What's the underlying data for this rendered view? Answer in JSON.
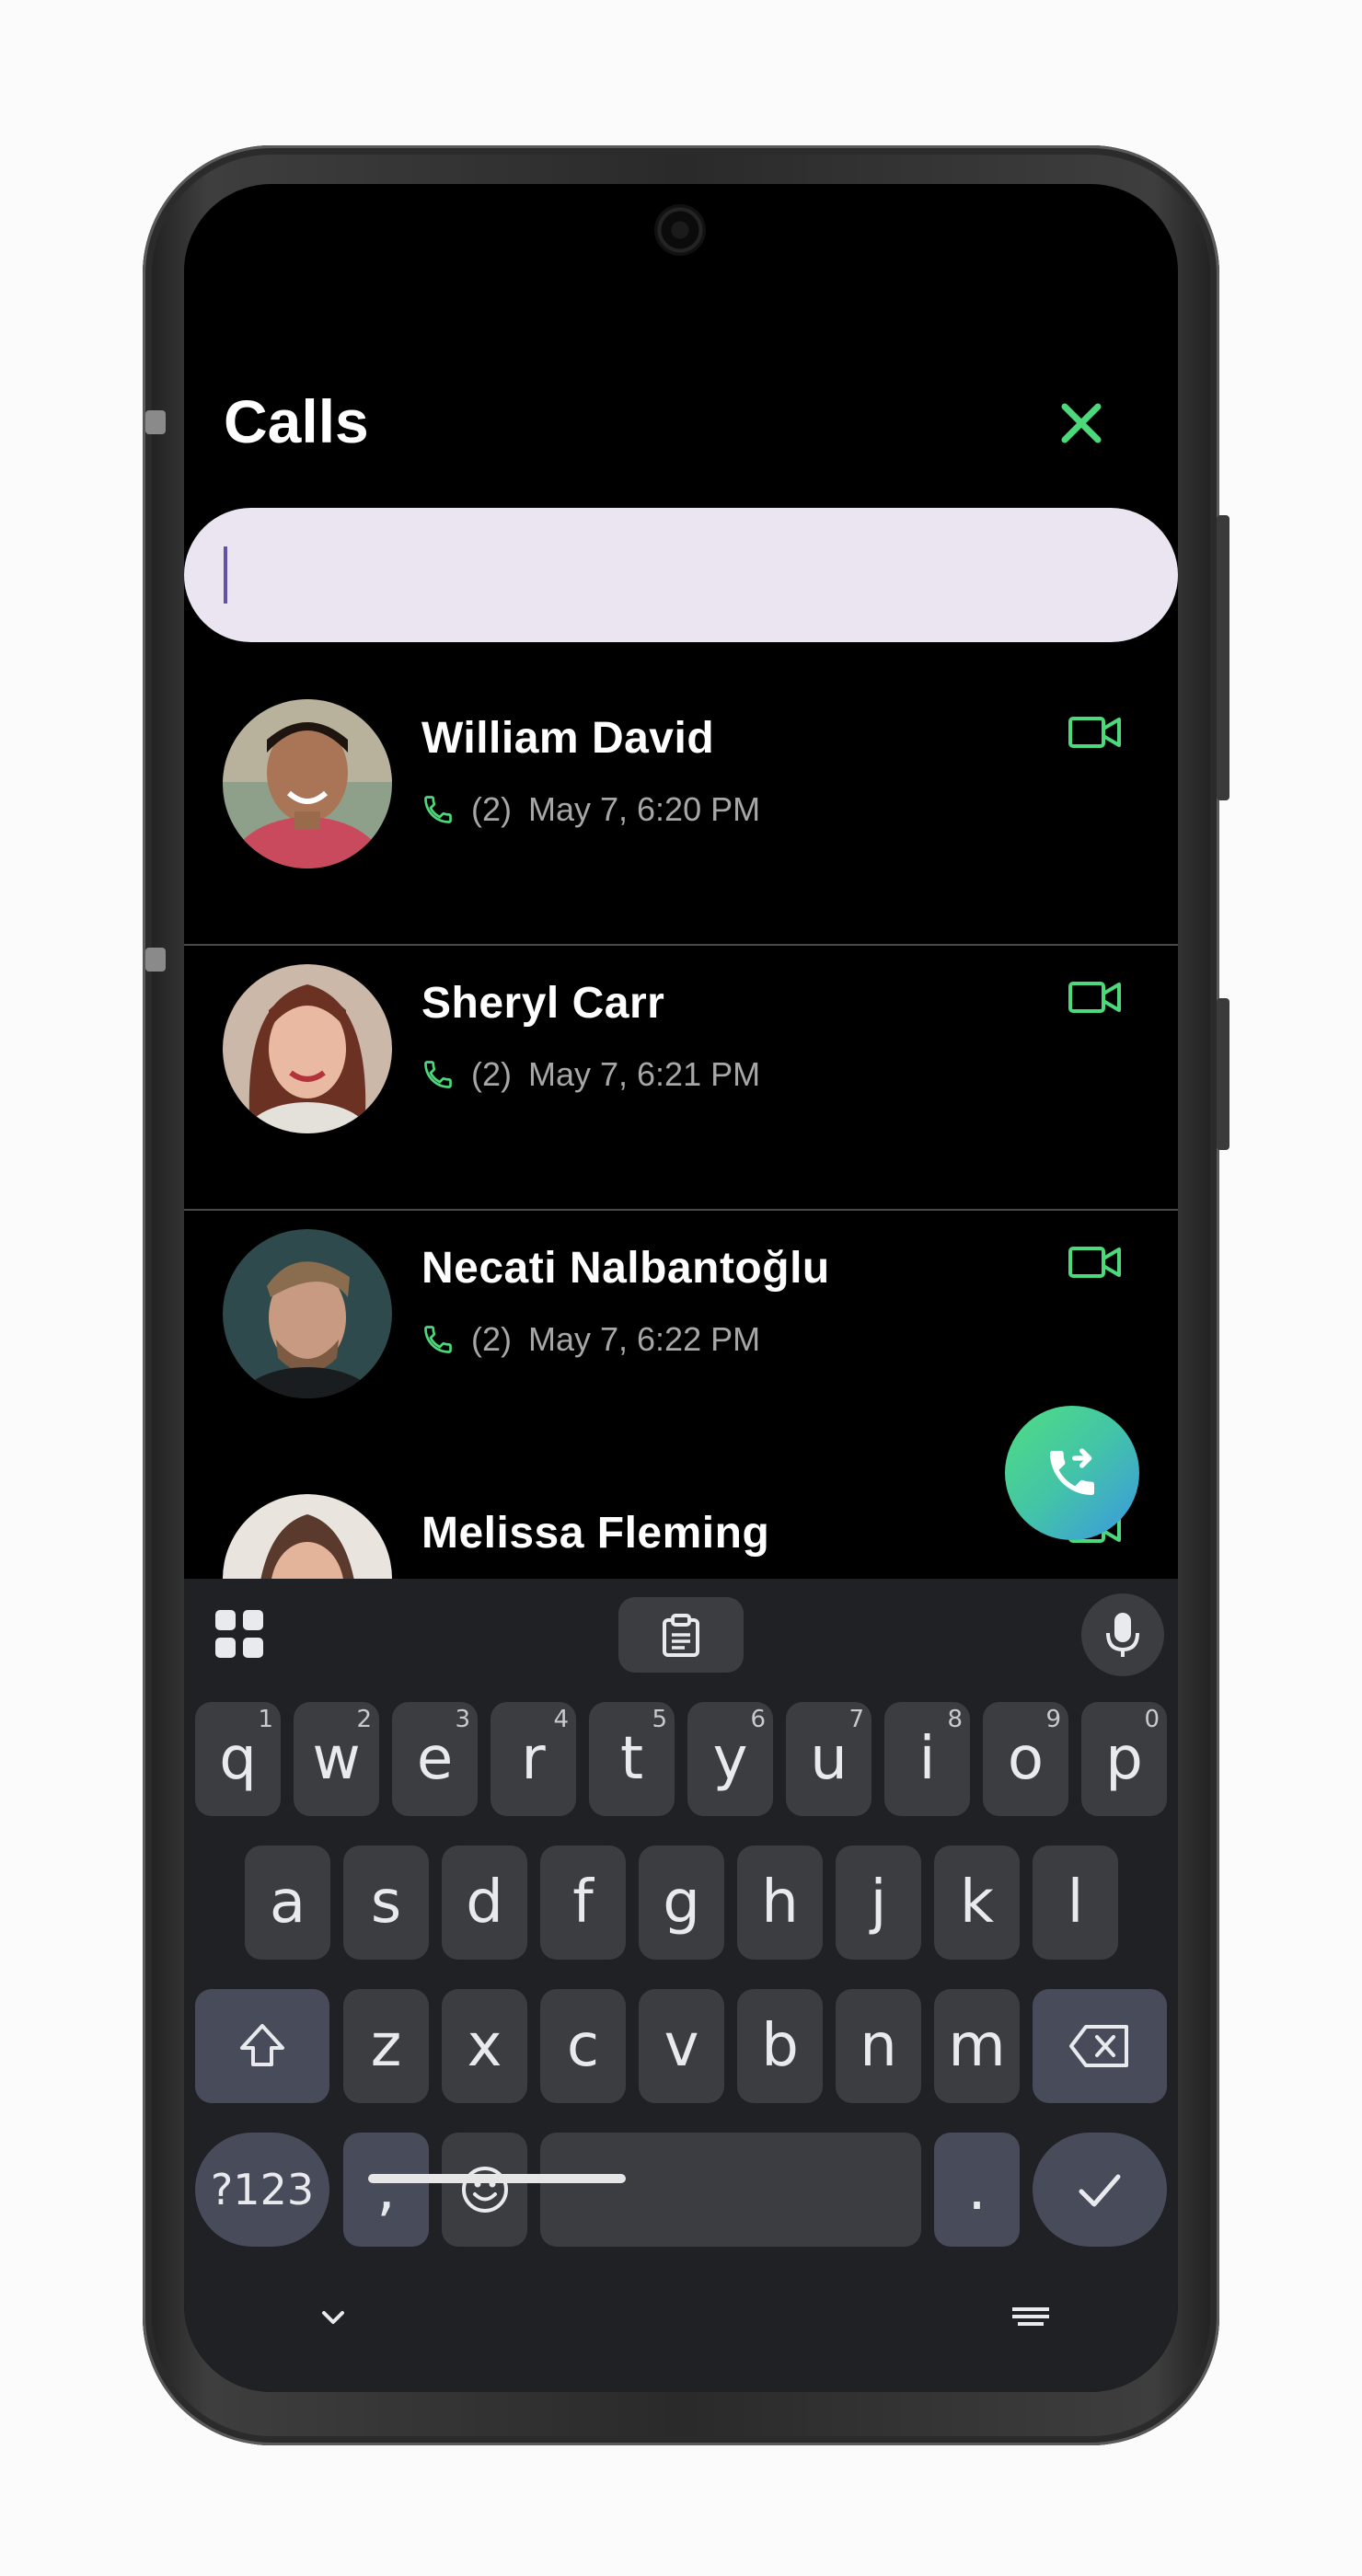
{
  "header": {
    "title": "Calls"
  },
  "search": {
    "value": "",
    "placeholder": ""
  },
  "calls": [
    {
      "name": "William David",
      "count": "(2)",
      "time": "May 7, 6:20 PM",
      "avatar_color": "#7a5a48"
    },
    {
      "name": "Sheryl Carr",
      "count": "(2)",
      "time": "May 7, 6:21 PM",
      "avatar_color": "#9a6a55"
    },
    {
      "name": "Necati Nalbantoğlu",
      "count": "(2)",
      "time": "May 7, 6:22 PM",
      "avatar_color": "#3c4a4d"
    },
    {
      "name": "Melissa Fleming",
      "count": "",
      "time": "",
      "avatar_color": "#8d6e63"
    }
  ],
  "keyboard": {
    "row1": [
      {
        "k": "q",
        "h": "1"
      },
      {
        "k": "w",
        "h": "2"
      },
      {
        "k": "e",
        "h": "3"
      },
      {
        "k": "r",
        "h": "4"
      },
      {
        "k": "t",
        "h": "5"
      },
      {
        "k": "y",
        "h": "6"
      },
      {
        "k": "u",
        "h": "7"
      },
      {
        "k": "i",
        "h": "8"
      },
      {
        "k": "o",
        "h": "9"
      },
      {
        "k": "p",
        "h": "0"
      }
    ],
    "row2": [
      "a",
      "s",
      "d",
      "f",
      "g",
      "h",
      "j",
      "k",
      "l"
    ],
    "row3": [
      "z",
      "x",
      "c",
      "v",
      "b",
      "n",
      "m"
    ],
    "symbols_label": "?123",
    "comma": ",",
    "period": "."
  },
  "colors": {
    "accent": "#4cd97b",
    "search_bg": "#ebe5f1",
    "keyboard_bg": "#202124"
  },
  "icons": [
    "close-icon",
    "phone-icon",
    "video-icon",
    "call-forward-icon",
    "apps-grid-icon",
    "clipboard-icon",
    "mic-icon",
    "shift-icon",
    "backspace-icon",
    "emoji-icon",
    "check-icon",
    "chevron-down-icon",
    "keyboard-icon"
  ]
}
